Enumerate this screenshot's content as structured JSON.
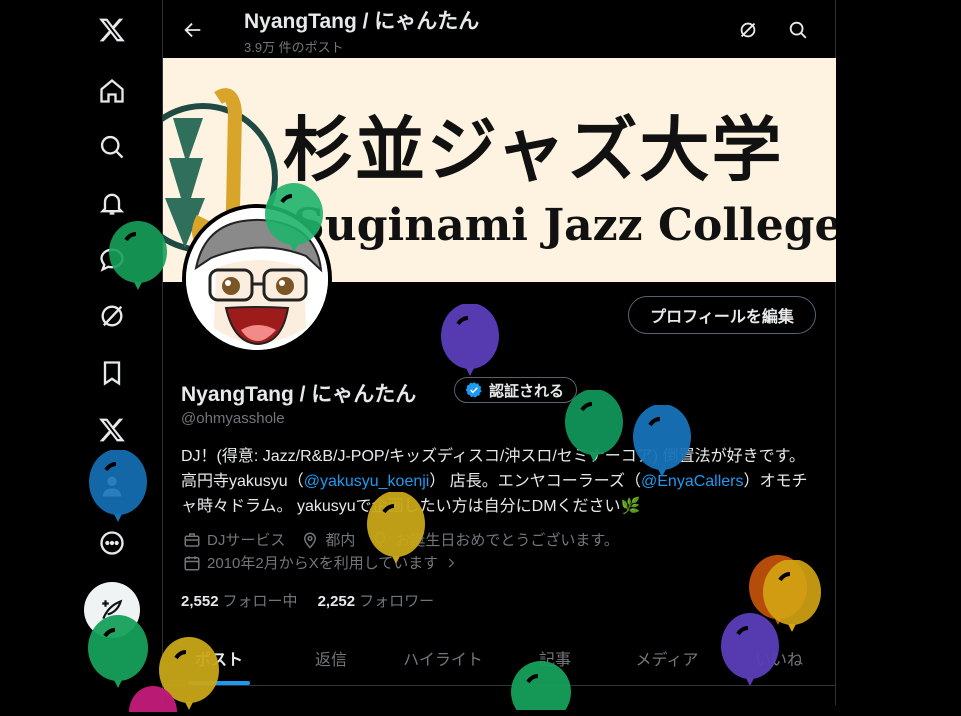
{
  "header": {
    "title": "NyangTang / にゃんたん",
    "post_count": "3.9万 件のポスト"
  },
  "banner": {
    "title_jp": "杉並ジャズ大学",
    "title_en": "Suginami Jazz College"
  },
  "profile": {
    "name": "NyangTang / にゃんたん",
    "verified_label": "認証される",
    "handle": "@ohmyasshole",
    "edit_button": "プロフィールを編集",
    "bio_part1": "DJ！(得意: Jazz/R&B/J-POP/キッズディスコ/沖スロ/セミナーコア) 倒置法が好きです。高円寺yakusyu（",
    "bio_link1": "@yakusyu_koenji",
    "bio_part2": "） 店長。エンヤコーラーズ（",
    "bio_link2": "@EnyaCallers",
    "bio_part3": "）オモチャ時々ドラム。 yakusyuで企画したい方は自分にDMください🌿",
    "category": "DJサービス",
    "location": "都内",
    "birthday": "お誕生日おめでとうございます。",
    "joined": "2010年2月からXを利用しています",
    "following_count": "2,552",
    "following_label": "フォロー中",
    "followers_count": "2,252",
    "followers_label": "フォロワー"
  },
  "tabs": [
    {
      "label": "ポスト"
    },
    {
      "label": "返信"
    },
    {
      "label": "ハイライト"
    },
    {
      "label": "記事"
    },
    {
      "label": "メディア"
    },
    {
      "label": "いいね"
    }
  ],
  "colors": {
    "accent": "#1d9bf0",
    "background": "#000000",
    "banner_bg": "#fdf3e0"
  }
}
